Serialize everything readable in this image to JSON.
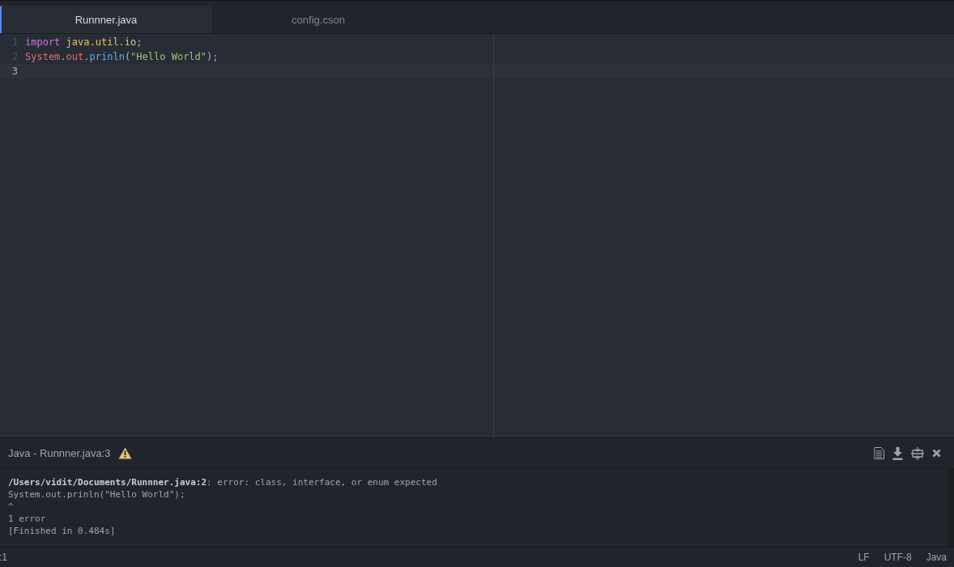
{
  "tabs": [
    {
      "label": "Runnner.java",
      "selected": true
    },
    {
      "label": "config.cson",
      "selected": false
    }
  ],
  "editor": {
    "lines": [
      {
        "number": "1",
        "current": false,
        "tokens": [
          {
            "text": "import ",
            "kind": "keyword"
          },
          {
            "text": "java.util.io",
            "kind": "type"
          },
          {
            "text": ";",
            "kind": "plain"
          }
        ]
      },
      {
        "number": "2",
        "current": false,
        "tokens": [
          {
            "text": "System",
            "kind": "variable"
          },
          {
            "text": ".",
            "kind": "plain"
          },
          {
            "text": "out",
            "kind": "variable"
          },
          {
            "text": ".",
            "kind": "plain"
          },
          {
            "text": "prinln",
            "kind": "function"
          },
          {
            "text": "(",
            "kind": "plain"
          },
          {
            "text": "\"Hello World\"",
            "kind": "string"
          },
          {
            "text": ");",
            "kind": "plain"
          }
        ]
      },
      {
        "number": "3",
        "current": true
      }
    ]
  },
  "panel": {
    "title": "Java - Runnner.java:3",
    "warning": true,
    "output": [
      "**/Users/vidit/Documents/Runnner.java:2**: error: class, interface, or enum expected",
      "System.out.prinln(\"Hello World\");",
      "^",
      "1 error",
      "[Finished in 0.484s]"
    ]
  },
  "status_bar": {
    "left": ":1",
    "right": [
      "LF",
      "UTF-8",
      "Java"
    ]
  }
}
